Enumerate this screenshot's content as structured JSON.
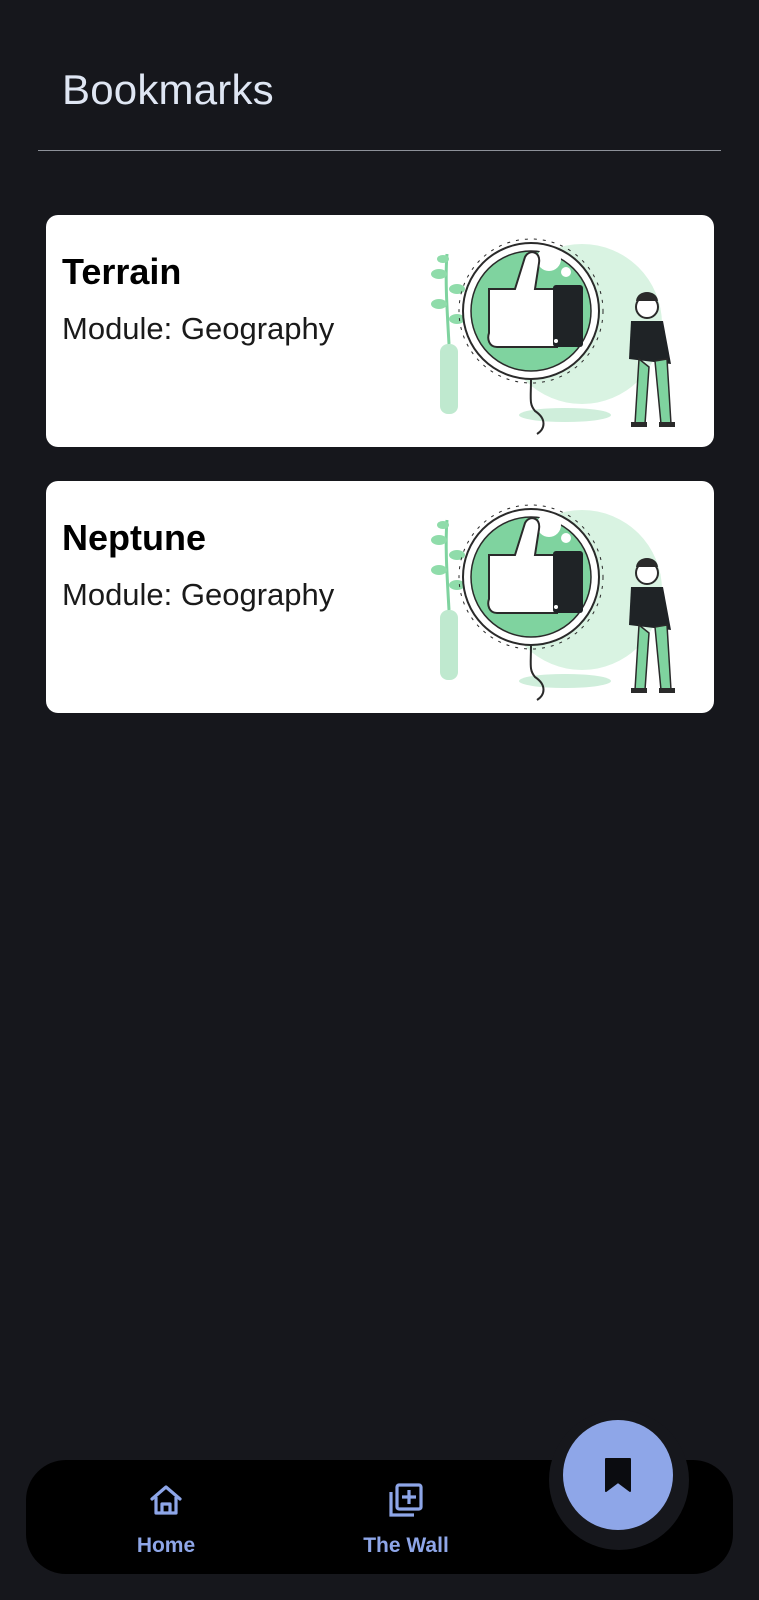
{
  "page": {
    "title": "Bookmarks"
  },
  "bookmarks": [
    {
      "title": "Terrain",
      "module": "Module: Geography"
    },
    {
      "title": "Neptune",
      "module": "Module: Geography"
    }
  ],
  "nav": {
    "home_label": "Home",
    "wall_label": "The Wall",
    "fab_icon": "bookmark-icon"
  },
  "colors": {
    "background": "#16171c",
    "accent": "#8ea6e8",
    "card": "#ffffff",
    "illustration_green": "#6fcf8f"
  }
}
